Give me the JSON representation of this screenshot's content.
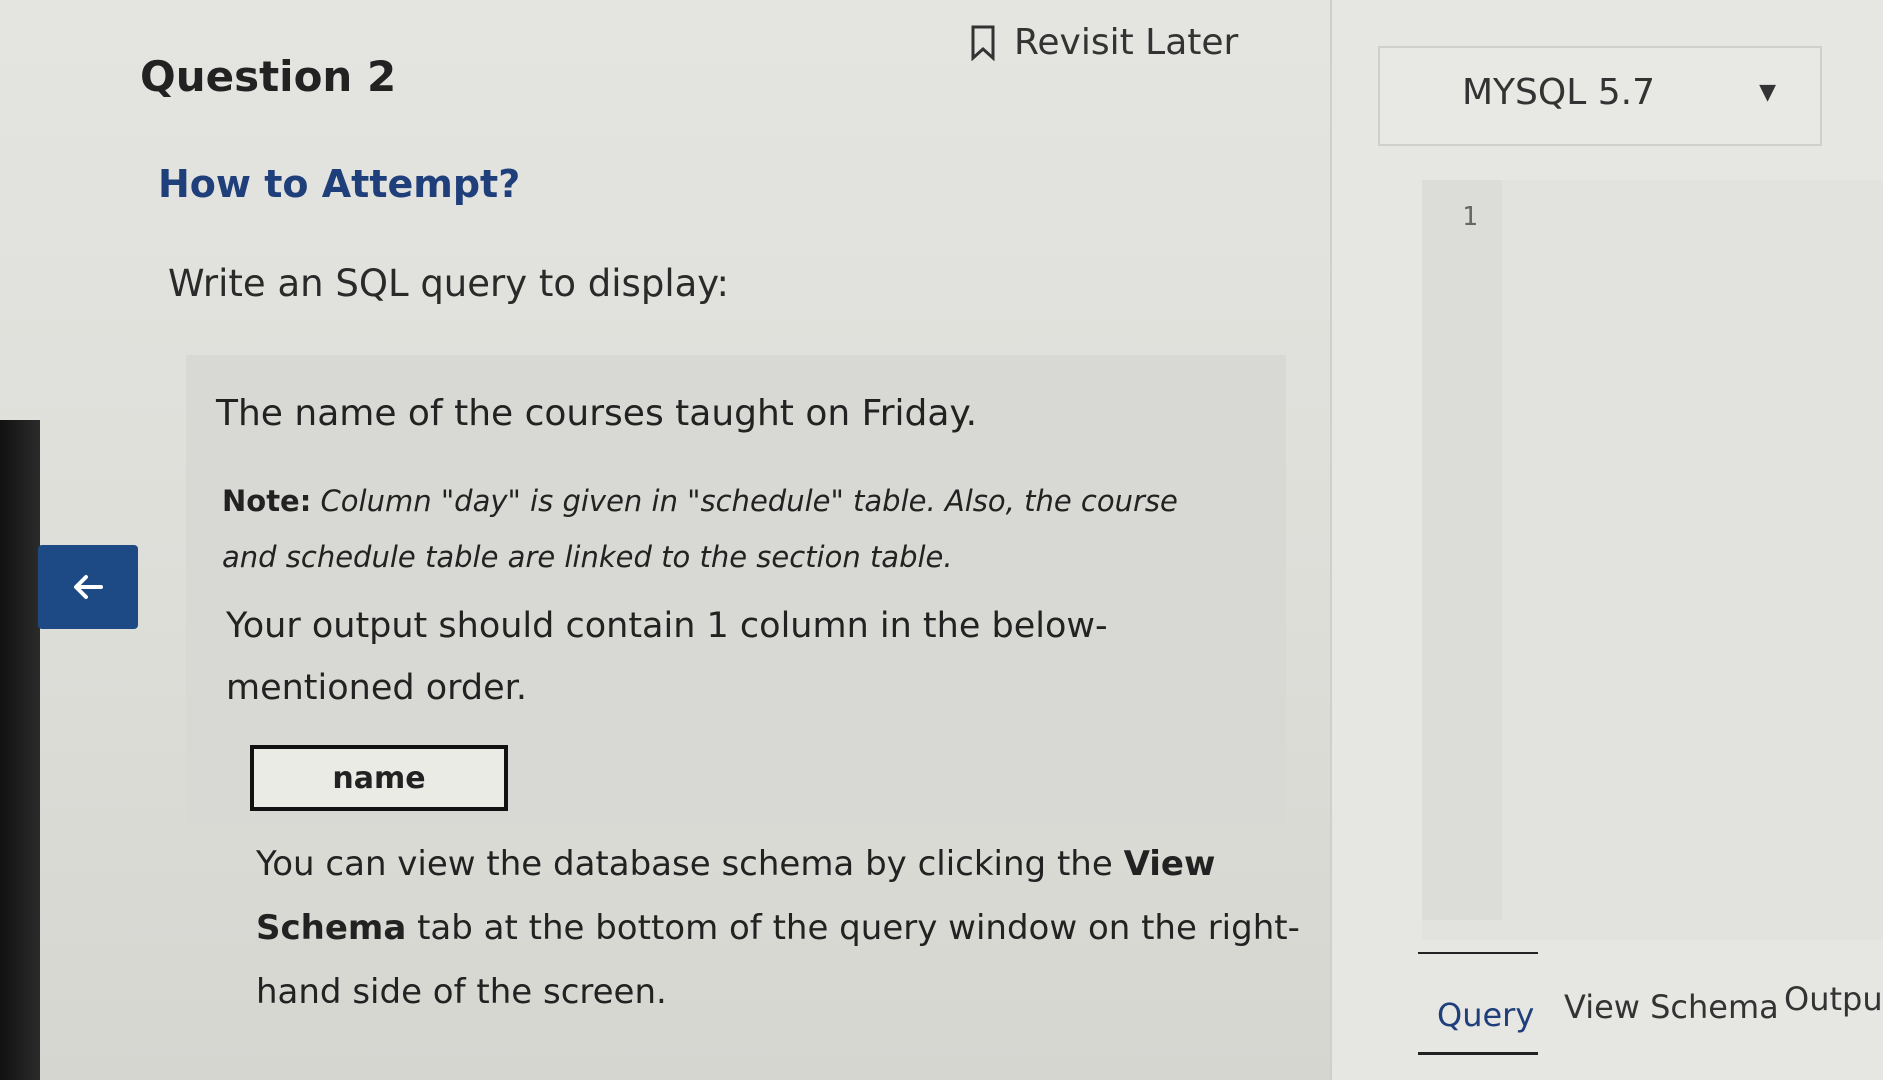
{
  "question": {
    "title": "Question 2",
    "revisit_label": "Revisit Later",
    "how_to_attempt": "How to Attempt?",
    "instruction": "Write an SQL query to display:",
    "task": "The name of the courses taught on Friday.",
    "note_label": "Note:",
    "note_text": " Column \"day\" is given in \"schedule\" table. Also, the course and schedule table are linked to the section table.",
    "output_text": "Your output should contain 1 column in the below-mentioned order.",
    "column_name": "name",
    "schema_pre": "You can view the database schema by clicking the ",
    "schema_bold": "View Schema",
    "schema_post": " tab at the bottom of the query window on the right-hand side of the screen."
  },
  "editor": {
    "db_select": "MYSQL 5.7",
    "line_number": "1"
  },
  "tabs": {
    "query": "Query",
    "view_schema": "View Schema",
    "output": "Output"
  }
}
